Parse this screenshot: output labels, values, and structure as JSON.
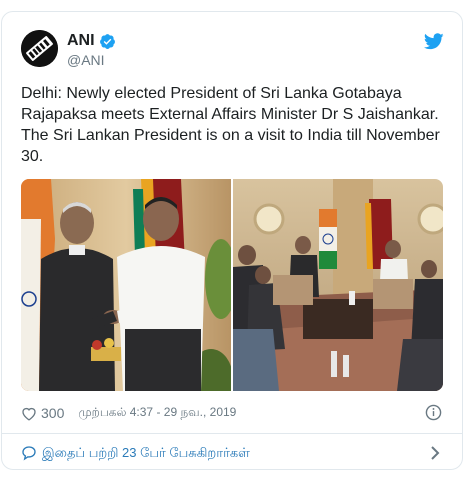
{
  "tweet": {
    "display_name": "ANI",
    "handle": "@ANI",
    "text": "Delhi: Newly elected President of Sri Lanka Gotabaya Rajapaksa meets External Affairs Minister Dr S Jaishankar. The Sri Lankan President is on a visit to India till November 30.",
    "likes": "300",
    "timestamp": "முற்பகல் 4:37 - 29 நவ., 2019",
    "replies_text": "இதைப் பற்றி 23 பேர் பேசுகிறார்கள்"
  },
  "icons": {
    "avatar": "ani-logo",
    "verified": "verified-badge-icon",
    "brand": "twitter-bird-icon",
    "like": "heart-icon",
    "info": "info-icon",
    "reply": "speech-bubble-icon",
    "more": "chevron-right-icon"
  },
  "colors": {
    "link": "#2b7bb9",
    "verified": "#1da1f2",
    "muted": "#697882",
    "text": "#1c2022",
    "border": "#e1e8ed"
  }
}
